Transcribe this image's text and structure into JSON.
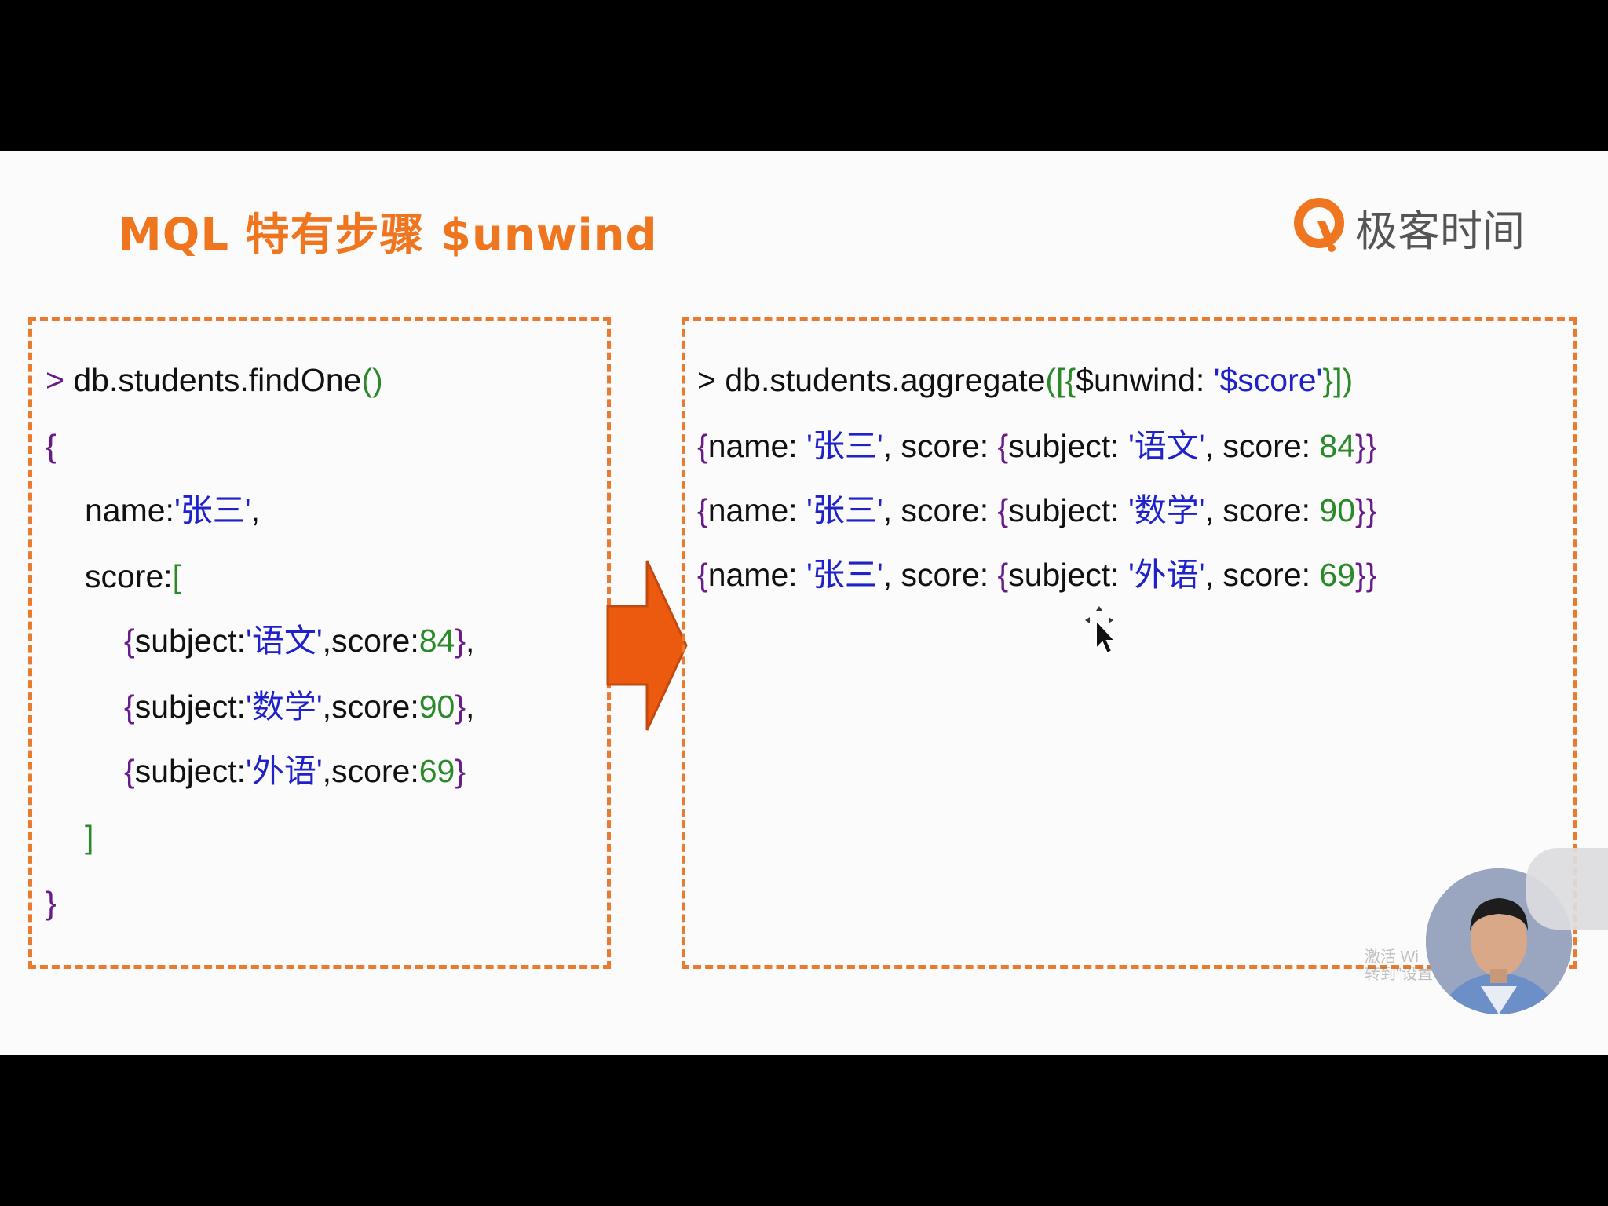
{
  "slide": {
    "title": "MQL 特有步骤 $unwind",
    "brand": "极客时间"
  },
  "left_code": {
    "line1": {
      "prompt": ">",
      "cmd": "db.students.findOne",
      "paren": "()"
    },
    "open_brace": "{",
    "name_key": "name:",
    "name_val": "'张三'",
    "name_comma": ",",
    "score_key": "score:",
    "score_bracket": "[",
    "items": [
      {
        "open": "{",
        "key": "subject:",
        "subject": "'语文'",
        "score_key": ",score:",
        "score": "84",
        "close": "}",
        "comma": ","
      },
      {
        "open": "{",
        "key": "subject:",
        "subject": "'数学'",
        "score_key": ",score:",
        "score": "90",
        "close": "}",
        "comma": ","
      },
      {
        "open": "{",
        "key": "subject:",
        "subject": "'外语'",
        "score_key": ",score:",
        "score": "69",
        "close": "}",
        "comma": ""
      }
    ],
    "close_bracket": "]",
    "close_brace": "}"
  },
  "right_code": {
    "command": {
      "prompt": ">",
      "cmd": "db.students.aggregate",
      "open": "([{",
      "key": "$unwind: ",
      "val": "'$score'",
      "close": "}])"
    },
    "results": [
      {
        "open": "{",
        "name_key": "name: ",
        "name": "'张三'",
        "mid": ", score: ",
        "inner_open": "{",
        "subject_key": "subject: ",
        "subject": "'语文'",
        "score_key": ", score: ",
        "score": "84",
        "close": "}}"
      },
      {
        "open": "{",
        "name_key": "name: ",
        "name": "'张三'",
        "mid": ", score: ",
        "inner_open": "{",
        "subject_key": "subject: ",
        "subject": "'数学'",
        "score_key": ", score: ",
        "score": "90",
        "close": "}}"
      },
      {
        "open": "{",
        "name_key": "name: ",
        "name": "'张三'",
        "mid": ", score: ",
        "inner_open": "{",
        "subject_key": "subject: ",
        "subject": "'外语'",
        "score_key": ", score: ",
        "score": "69",
        "close": "}}"
      }
    ]
  },
  "overlay": {
    "watermark_line1": "激活 Wi",
    "watermark_line2": "转到\"设置\"以"
  },
  "colors": {
    "accent": "#f0751f",
    "dash_border": "#ea7a2e",
    "string_blue": "#1e22c8",
    "number_green": "#2a8a2a",
    "punct_purple": "#6a1b8a"
  },
  "icons": [
    "brand-logo-icon",
    "right-arrow-icon",
    "move-cursor-icon"
  ]
}
